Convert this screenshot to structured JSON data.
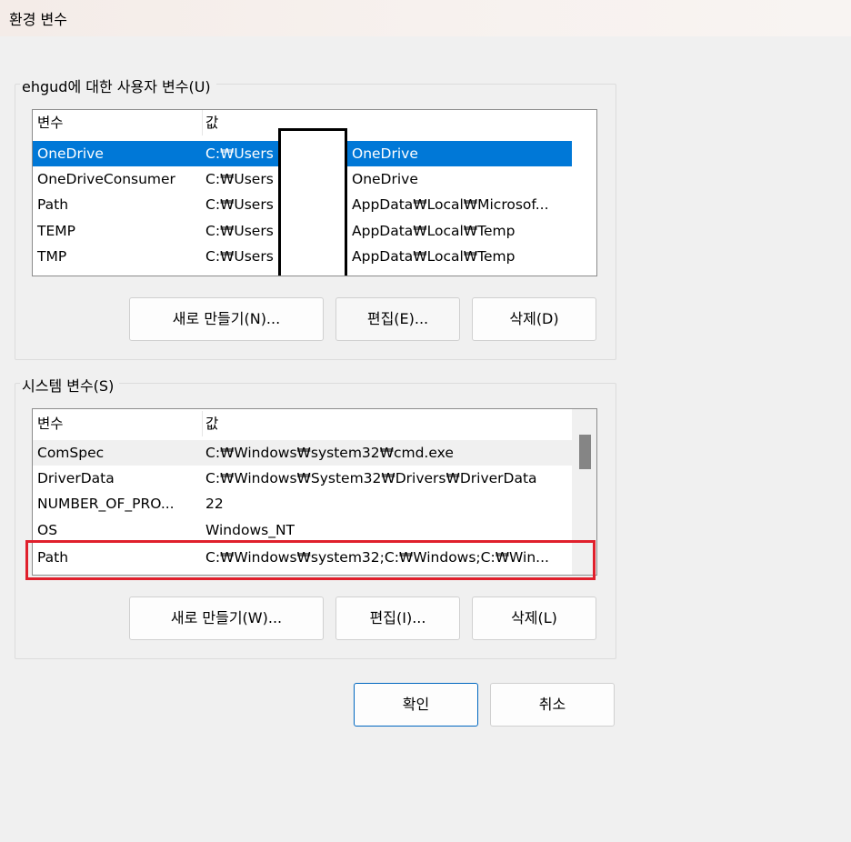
{
  "window": {
    "title": "환경 변수"
  },
  "user_vars": {
    "label": "ehgud에 대한 사용자 변수(U)",
    "columns": [
      "변수",
      "값"
    ],
    "rows": [
      {
        "name": "OneDrive",
        "value_prefix": "C:₩Users",
        "value_suffix": "OneDrive"
      },
      {
        "name": "OneDriveConsumer",
        "value_prefix": "C:₩Users",
        "value_suffix": "OneDrive"
      },
      {
        "name": "Path",
        "value_prefix": "C:₩Users",
        "value_suffix": "AppData₩Local₩Microsof..."
      },
      {
        "name": "TEMP",
        "value_prefix": "C:₩Users",
        "value_suffix": "AppData₩Local₩Temp"
      },
      {
        "name": "TMP",
        "value_prefix": "C:₩Users",
        "value_suffix": "AppData₩Local₩Temp"
      }
    ],
    "buttons": {
      "new": "새로 만들기(N)...",
      "edit": "편집(E)...",
      "delete": "삭제(D)"
    }
  },
  "system_vars": {
    "label": "시스템 변수(S)",
    "columns": [
      "변수",
      "값"
    ],
    "rows": [
      {
        "name": "ComSpec",
        "value": "C:₩Windows₩system32₩cmd.exe"
      },
      {
        "name": "DriverData",
        "value": "C:₩Windows₩System32₩Drivers₩DriverData"
      },
      {
        "name": "NUMBER_OF_PRO...",
        "value": "22"
      },
      {
        "name": "OS",
        "value": "Windows_NT"
      },
      {
        "name": "Path",
        "value": "C:₩Windows₩system32;C:₩Windows;C:₩Win..."
      }
    ],
    "buttons": {
      "new": "새로 만들기(W)...",
      "edit": "편집(I)...",
      "delete": "삭제(L)"
    }
  },
  "dialog_buttons": {
    "ok": "확인",
    "cancel": "취소"
  },
  "colors": {
    "selection": "#0078d7",
    "highlight_box": "#e0202c",
    "primary_border": "#0067c0"
  }
}
